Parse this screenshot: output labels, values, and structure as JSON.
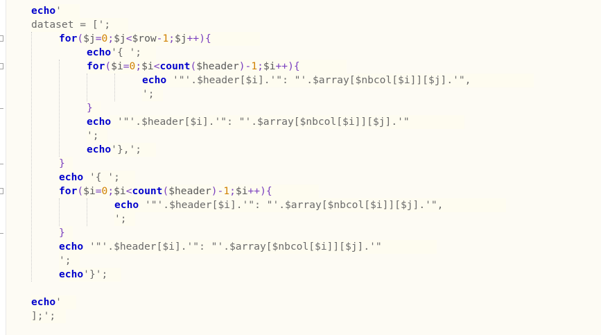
{
  "window": {
    "app_title": "",
    "colors": {
      "background": "#fdfbf4",
      "keyword": "#0000cc",
      "string": "#6a6a6a",
      "operator": "#7a3fbf",
      "number": "#d08000"
    }
  },
  "gutter": {
    "fold_icon": "fold-toggle-icon"
  },
  "code_lines": [
    {
      "tokens": [
        {
          "t": "echo",
          "c": "kw"
        },
        {
          "t": "'",
          "c": "str"
        }
      ]
    },
    {
      "tokens": [
        {
          "t": "dataset = [';",
          "c": "str"
        }
      ]
    },
    {
      "tokens": [
        {
          "t": "for",
          "c": "kw"
        },
        {
          "t": "(",
          "c": "punc"
        },
        {
          "t": "$j",
          "c": "var"
        },
        {
          "t": "=",
          "c": "punc"
        },
        {
          "t": "0",
          "c": "num"
        },
        {
          "t": ";",
          "c": "punc"
        },
        {
          "t": "$j",
          "c": "var"
        },
        {
          "t": "<",
          "c": "punc"
        },
        {
          "t": "$row",
          "c": "var"
        },
        {
          "t": "-",
          "c": "punc"
        },
        {
          "t": "1",
          "c": "num"
        },
        {
          "t": ";",
          "c": "punc"
        },
        {
          "t": "$j",
          "c": "var"
        },
        {
          "t": "++){",
          "c": "punc"
        }
      ]
    },
    {
      "tokens": [
        {
          "t": "echo",
          "c": "kw"
        },
        {
          "t": "'{ ';",
          "c": "str"
        }
      ]
    },
    {
      "tokens": [
        {
          "t": "for",
          "c": "kw"
        },
        {
          "t": "(",
          "c": "punc"
        },
        {
          "t": "$i",
          "c": "var"
        },
        {
          "t": "=",
          "c": "punc"
        },
        {
          "t": "0",
          "c": "num"
        },
        {
          "t": ";",
          "c": "punc"
        },
        {
          "t": "$i",
          "c": "var"
        },
        {
          "t": "<",
          "c": "punc"
        },
        {
          "t": "count",
          "c": "fn"
        },
        {
          "t": "(",
          "c": "punc"
        },
        {
          "t": "$header",
          "c": "var"
        },
        {
          "t": ")-",
          "c": "punc"
        },
        {
          "t": "1",
          "c": "num"
        },
        {
          "t": ";",
          "c": "punc"
        },
        {
          "t": "$i",
          "c": "var"
        },
        {
          "t": "++){",
          "c": "punc"
        }
      ]
    },
    {
      "tokens": [
        {
          "t": "echo",
          "c": "kw"
        },
        {
          "t": " '\"'.$header[$i].'\": \"'.$array[$nbcol[$i]][$j].'\",",
          "c": "str"
        }
      ]
    },
    {
      "tokens": [
        {
          "t": "';",
          "c": "str"
        }
      ]
    },
    {
      "tokens": [
        {
          "t": "}",
          "c": "punc"
        }
      ]
    },
    {
      "tokens": [
        {
          "t": "echo",
          "c": "kw"
        },
        {
          "t": " '\"'.$header[$i].'\": \"'.$array[$nbcol[$i]][$j].'\"",
          "c": "str"
        }
      ]
    },
    {
      "tokens": [
        {
          "t": "';",
          "c": "str"
        }
      ]
    },
    {
      "tokens": [
        {
          "t": "echo",
          "c": "kw"
        },
        {
          "t": "'},';",
          "c": "str"
        }
      ]
    },
    {
      "tokens": [
        {
          "t": "}",
          "c": "punc"
        }
      ]
    },
    {
      "tokens": [
        {
          "t": "echo",
          "c": "kw"
        },
        {
          "t": " '{ ';",
          "c": "str"
        }
      ]
    },
    {
      "tokens": [
        {
          "t": "for",
          "c": "kw"
        },
        {
          "t": "(",
          "c": "punc"
        },
        {
          "t": "$i",
          "c": "var"
        },
        {
          "t": "=",
          "c": "punc"
        },
        {
          "t": "0",
          "c": "num"
        },
        {
          "t": ";",
          "c": "punc"
        },
        {
          "t": "$i",
          "c": "var"
        },
        {
          "t": "<",
          "c": "punc"
        },
        {
          "t": "count",
          "c": "fn"
        },
        {
          "t": "(",
          "c": "punc"
        },
        {
          "t": "$header",
          "c": "var"
        },
        {
          "t": ")-",
          "c": "punc"
        },
        {
          "t": "1",
          "c": "num"
        },
        {
          "t": ";",
          "c": "punc"
        },
        {
          "t": "$i",
          "c": "var"
        },
        {
          "t": "++){",
          "c": "punc"
        }
      ]
    },
    {
      "tokens": [
        {
          "t": "echo",
          "c": "kw"
        },
        {
          "t": " '\"'.$header[$i].'\": \"'.$array[$nbcol[$i]][$j].'\",",
          "c": "str"
        }
      ]
    },
    {
      "tokens": [
        {
          "t": "';",
          "c": "str"
        }
      ]
    },
    {
      "tokens": [
        {
          "t": "}",
          "c": "punc"
        }
      ]
    },
    {
      "tokens": [
        {
          "t": "echo",
          "c": "kw"
        },
        {
          "t": " '\"'.$header[$i].'\": \"'.$array[$nbcol[$i]][$j].'\"",
          "c": "str"
        }
      ]
    },
    {
      "tokens": [
        {
          "t": "';",
          "c": "str"
        }
      ]
    },
    {
      "tokens": [
        {
          "t": "echo",
          "c": "kw"
        },
        {
          "t": "'}';",
          "c": "str"
        }
      ]
    },
    {
      "tokens": []
    },
    {
      "tokens": [
        {
          "t": "echo",
          "c": "kw"
        },
        {
          "t": "'",
          "c": "str"
        }
      ]
    },
    {
      "tokens": [
        {
          "t": "];';",
          "c": "str"
        }
      ]
    }
  ]
}
